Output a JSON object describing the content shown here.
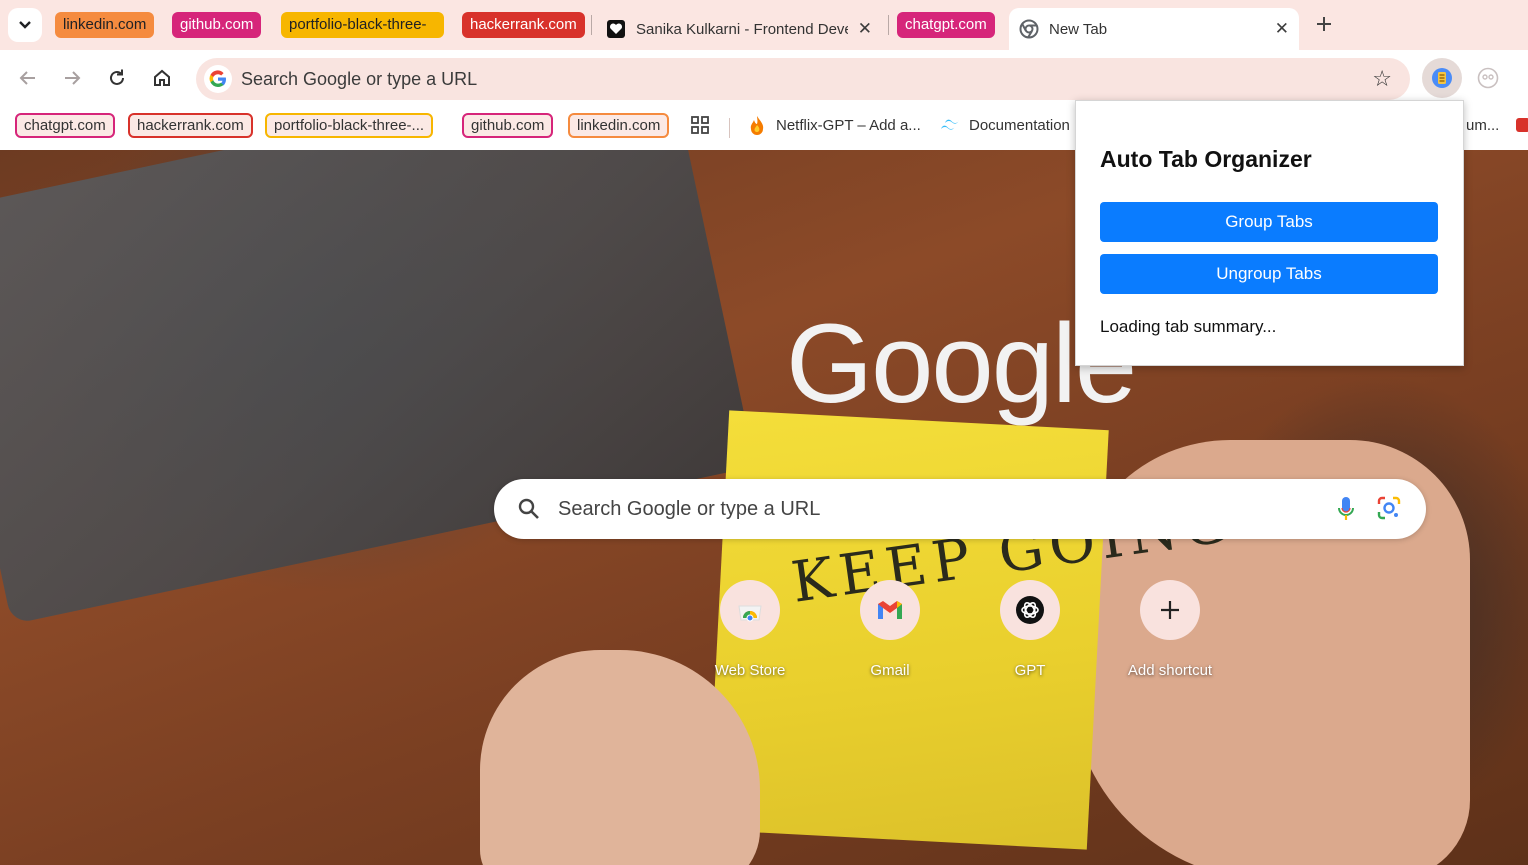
{
  "tab_groups": [
    {
      "label": "linkedin.com",
      "color": "#f58b3f"
    },
    {
      "label": "github.com",
      "color": "#d6257a"
    },
    {
      "label": "portfolio-black-three-",
      "color": "#f7b600"
    },
    {
      "label": "hackerrank.com",
      "color": "#d8322b"
    }
  ],
  "tabs": {
    "portfolio_title": "Sanika Kulkarni - Frontend Deve",
    "chatgpt_group": "chatgpt.com",
    "active_title": "New Tab"
  },
  "toolbar": {
    "omnibox_text": "Search Google or type a URL",
    "omnibox_icon": "G"
  },
  "bookmarks": {
    "groups": [
      "chatgpt.com",
      "hackerrank.com",
      "portfolio-black-three-...",
      "github.com",
      "linkedin.com"
    ],
    "netflix": "Netflix-GPT – Add a...",
    "documentation": "Documentation",
    "overflow": "um..."
  },
  "newtab": {
    "logo": "Google",
    "search_placeholder": "Search Google or type a URL",
    "shortcuts": [
      {
        "label": "Web Store",
        "icon": "webstore-icon"
      },
      {
        "label": "Gmail",
        "icon": "gmail-icon"
      },
      {
        "label": "GPT",
        "icon": "openai-icon"
      },
      {
        "label": "Add shortcut",
        "icon": "plus-icon"
      }
    ],
    "sticky_note_text": "KEEP GOING"
  },
  "popup": {
    "title": "Auto Tab Organizer",
    "group_button": "Group Tabs",
    "ungroup_button": "Ungroup Tabs",
    "status": "Loading tab summary..."
  },
  "colors": {
    "accent_blue": "#0a7cff",
    "tabstrip_bg": "#fbe6e2",
    "group_orange": "#f58b3f",
    "group_pink": "#d6257a",
    "group_yellow": "#f7b600",
    "group_red": "#d8322b"
  }
}
